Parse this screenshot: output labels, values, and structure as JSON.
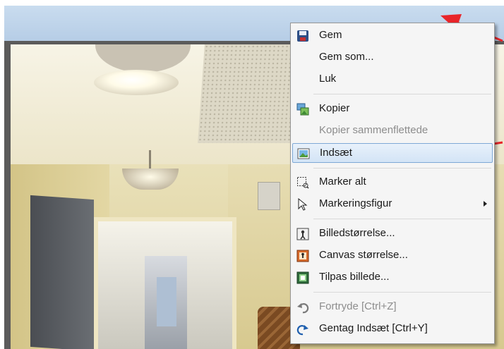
{
  "context_menu": {
    "items": [
      {
        "label": "Gem",
        "icon": "save-icon",
        "disabled": false
      },
      {
        "label": "Gem som...",
        "icon": "",
        "disabled": false
      },
      {
        "label": "Luk",
        "icon": "",
        "disabled": false
      },
      {
        "label": "Kopier",
        "icon": "copy-image-icon",
        "disabled": false
      },
      {
        "label": "Kopier sammenflettede",
        "icon": "",
        "disabled": true
      },
      {
        "label": "Indsæt",
        "icon": "paste-image-icon",
        "disabled": false,
        "highlighted": true
      },
      {
        "label": "Marker alt",
        "icon": "select-all-icon",
        "disabled": false
      },
      {
        "label": "Markeringsfigur",
        "icon": "selection-cursor-icon",
        "disabled": false,
        "has_submenu": true
      },
      {
        "label": "Billedstørrelse...",
        "icon": "image-size-icon",
        "disabled": false
      },
      {
        "label": "Canvas størrelse...",
        "icon": "canvas-size-icon",
        "disabled": false
      },
      {
        "label": "Tilpas billede...",
        "icon": "fit-image-icon",
        "disabled": false
      },
      {
        "label": "Fortryde [Ctrl+Z]",
        "icon": "undo-icon",
        "disabled": true
      },
      {
        "label": "Gentag Indsæt [Ctrl+Y]",
        "icon": "redo-icon",
        "disabled": false
      }
    ]
  },
  "colors": {
    "accent_arrow": "#e8252a",
    "highlight_border": "#7ea8d6",
    "disabled_text": "#8d8d8d"
  }
}
